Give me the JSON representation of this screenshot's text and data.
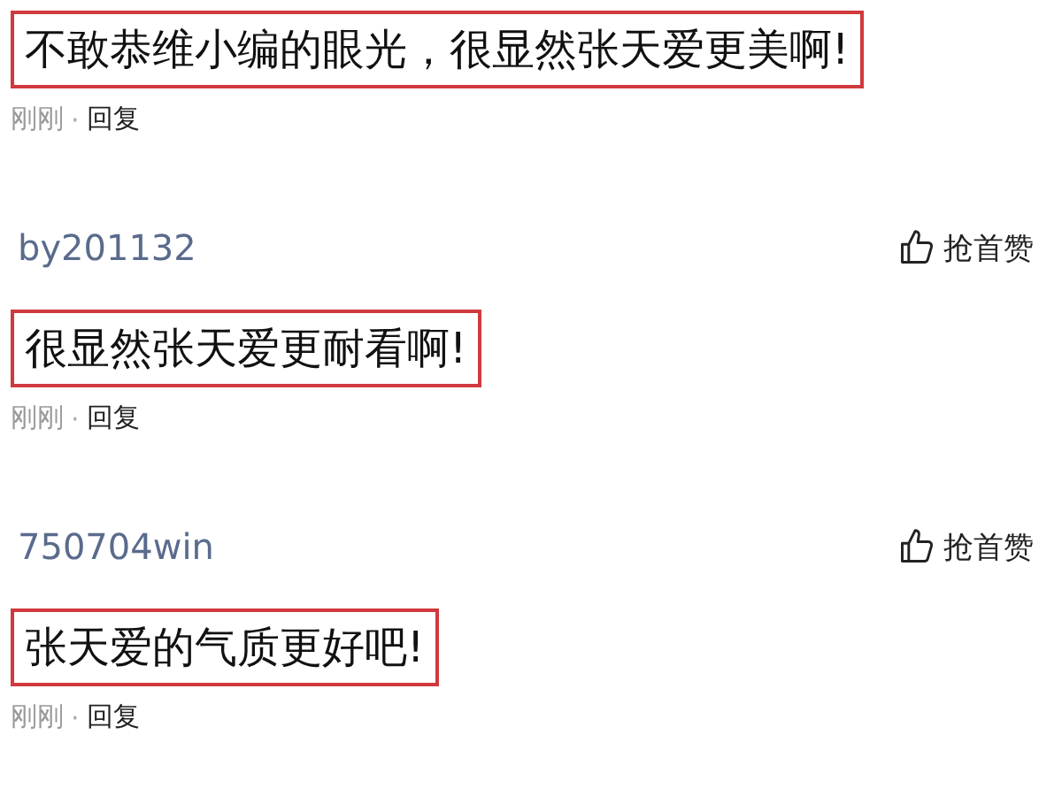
{
  "comments": [
    {
      "text": "不敢恭维小编的眼光，很显然张天爱更美啊!",
      "time": "刚刚",
      "separator": "·",
      "reply": "回复",
      "highlighted": true
    },
    {
      "username": "by201132",
      "like": "抢首赞",
      "text": "很显然张天爱更耐看啊!",
      "time": "刚刚",
      "separator": "·",
      "reply": "回复",
      "highlighted": true
    },
    {
      "username": "750704win",
      "like": "抢首赞",
      "text": "张天爱的气质更好吧!",
      "time": "刚刚",
      "separator": "·",
      "reply": "回复",
      "highlighted": true
    }
  ]
}
